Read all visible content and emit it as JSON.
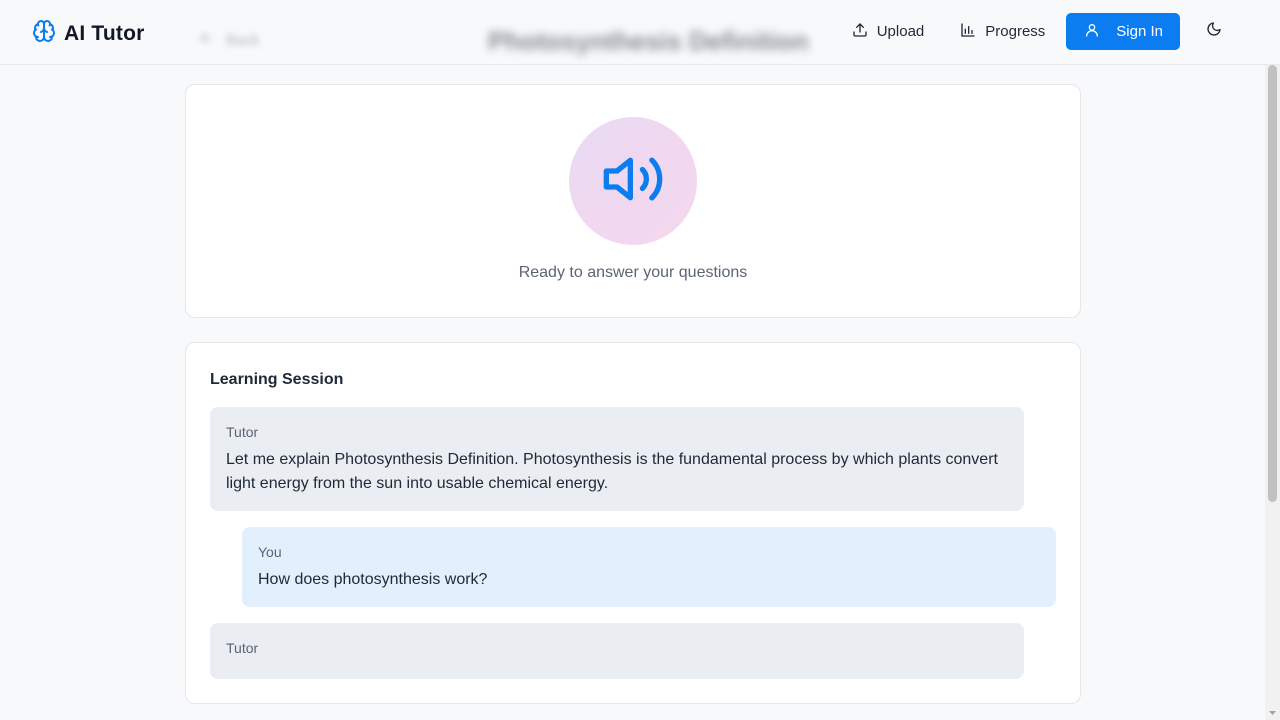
{
  "header": {
    "brand": "AI Tutor",
    "back_label": "Back",
    "page_title": "Photosynthesis Definition",
    "nav": {
      "upload": "Upload",
      "progress": "Progress",
      "sign_in": "Sign In"
    }
  },
  "voice": {
    "status": "Ready to answer your questions"
  },
  "session": {
    "title": "Learning Session",
    "messages": [
      {
        "sender": "Tutor",
        "text": "Let me explain Photosynthesis Definition. Photosynthesis is the fundamental process by which plants convert light energy from the sun into usable chemical energy."
      },
      {
        "sender": "You",
        "text": "How does photosynthesis work?"
      },
      {
        "sender": "Tutor",
        "text": ""
      }
    ]
  },
  "colors": {
    "accent": "#0b7df0",
    "tutor_bubble": "#eaedf1",
    "user_bubble": "#e2effc",
    "speaker_bg": "#f0d9f2"
  },
  "icons": {
    "brand": "brain-icon",
    "back": "arrow-left-icon",
    "upload": "upload-icon",
    "progress": "bar-chart-icon",
    "sign_in": "user-icon",
    "theme": "moon-icon",
    "voice": "speaker-icon"
  }
}
